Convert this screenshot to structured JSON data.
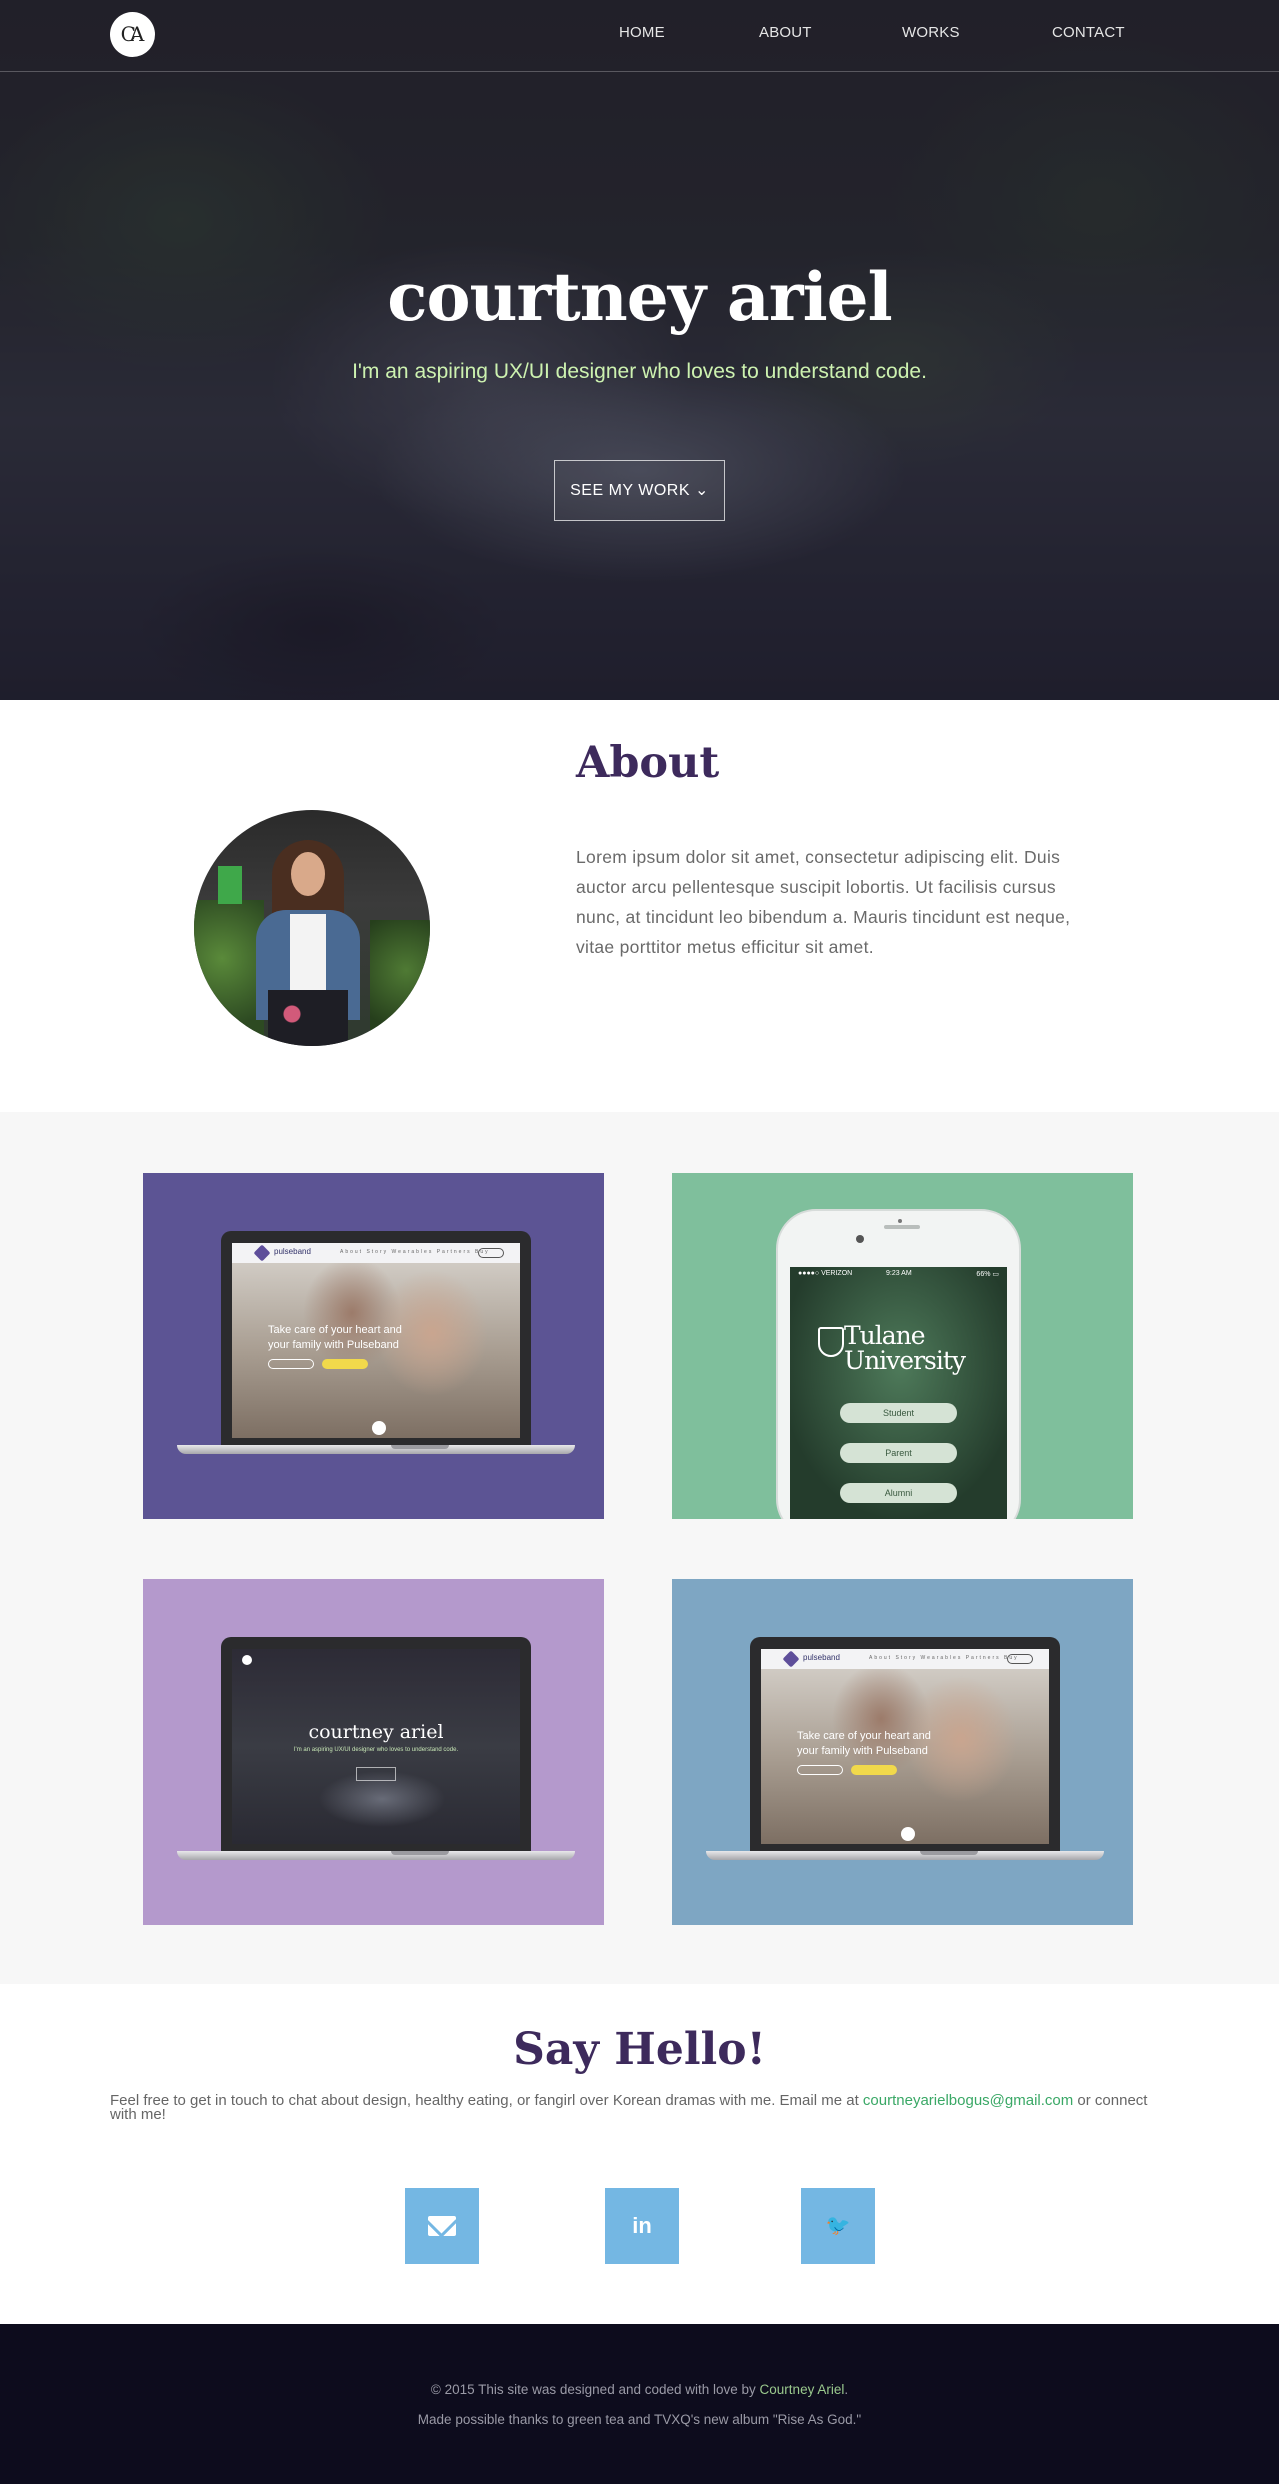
{
  "nav": {
    "logo": "CA",
    "links": [
      "HOME",
      "ABOUT",
      "WORKS",
      "CONTACT"
    ]
  },
  "hero": {
    "title": "courtney ariel",
    "subtitle": "I'm an aspiring UX/UI designer who loves to understand code.",
    "button": "SEE MY WORK ⌄"
  },
  "about": {
    "title": "About",
    "text": "Lorem ipsum dolor sit amet, consectetur adipiscing elit. Duis auctor arcu pellentesque suscipit lobortis. Ut facilisis cursus nunc, at tincidunt leo bibendum a. Mauris tincidunt est neque, vitae porttitor metus efficitur sit amet."
  },
  "works": {
    "tiles": [
      {
        "color": "#5c5494",
        "brand": "pulseband",
        "menu": "About Story Wearables Partners Buy",
        "headline": "Take care of your heart and your family with Pulseband",
        "cta": "BUY NOW"
      },
      {
        "color": "#7fbf9c",
        "carrier": "●●●●○ VERIZON",
        "time": "9:23 AM",
        "battery": "66% ▭",
        "brand": "Tulane University",
        "buttons": [
          "Student",
          "Parent",
          "Alumni"
        ]
      },
      {
        "color": "#b499cc",
        "title": "courtney ariel",
        "subtitle": "I'm an aspiring UX/UI designer who loves to understand code.",
        "cta": "SEE MY WORK"
      },
      {
        "color": "#7ea6c3",
        "brand": "pulseband",
        "menu": "About Story Wearables Partners Buy",
        "headline": "Take care of your heart and your family with Pulseband",
        "cta": "BUY NOW"
      }
    ]
  },
  "contact": {
    "title": "Say Hello!",
    "text_before": "Feel free to get in touch to chat about design, healthy eating, or fangirl over Korean dramas with me. Email me at ",
    "email": "courtneyarielbogus@gmail.com",
    "text_after": " or connect with me!",
    "social": [
      {
        "icon": "envelope-icon",
        "glyph": ""
      },
      {
        "icon": "linkedin-icon",
        "glyph": "in"
      },
      {
        "icon": "twitter-icon",
        "glyph": "🐦"
      }
    ],
    "social_color": "#74b7e3"
  },
  "footer": {
    "line1_before": "© 2015 This site was designed and coded with love by ",
    "line1_name": "Courtney Ariel",
    "line1_after": ".",
    "line2": "Made possible thanks to green tea and TVXQ's new album \"Rise As God.\""
  }
}
